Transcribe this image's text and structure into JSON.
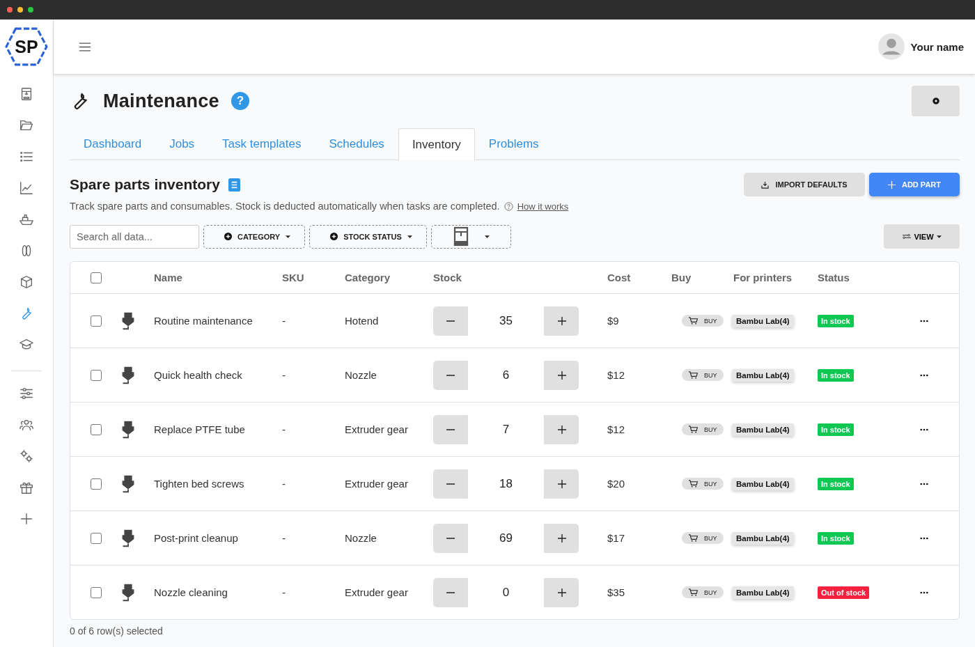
{
  "app": {
    "logo": "SP"
  },
  "sidebar": {
    "items": [
      {
        "selected": false
      },
      {
        "selected": false
      },
      {
        "selected": false
      },
      {
        "selected": false
      },
      {
        "selected": false
      },
      {
        "selected": false
      },
      {
        "selected": false
      },
      {
        "selected": true
      },
      {
        "selected": false
      },
      {
        "selected": false
      },
      {
        "selected": false
      },
      {
        "selected": false
      },
      {
        "selected": false
      },
      {
        "selected": false
      }
    ]
  },
  "header": {
    "user_name": "Your name"
  },
  "page": {
    "title": "Maintenance",
    "help": "?"
  },
  "tabs": [
    {
      "label": "Dashboard",
      "selected": false
    },
    {
      "label": "Jobs",
      "selected": false
    },
    {
      "label": "Task templates",
      "selected": false
    },
    {
      "label": "Schedules",
      "selected": false
    },
    {
      "label": "Inventory",
      "selected": true
    },
    {
      "label": "Problems",
      "selected": false
    }
  ],
  "section": {
    "title": "Spare parts inventory",
    "description": "Track spare parts and consumables. Stock is deducted automatically when tasks are completed.",
    "link": "How it works",
    "buttons": [
      {
        "label": "IMPORT DEFAULTS",
        "kind": "secondary"
      },
      {
        "label": "ADD PART",
        "kind": "primary"
      }
    ]
  },
  "toolbar": {
    "search": {
      "placeholder": "Search all data..."
    },
    "filters": [
      {
        "kind": "text",
        "label": "CATEGORY"
      },
      {
        "kind": "text",
        "label": "STOCK STATUS"
      },
      {
        "kind": "printer"
      }
    ],
    "view": "VIEW"
  },
  "table": {
    "header_checked": false,
    "columns": [
      "Name",
      "SKU",
      "Category",
      "Stock",
      "Cost",
      "Buy",
      "For printers",
      "Status"
    ],
    "rows": [
      {
        "checked": false,
        "name": "Routine maintenance",
        "sku": "-",
        "category": "Hotend",
        "stock": "35",
        "cost": "$9",
        "buy": "BUY",
        "printers": "Bambu Lab(4)",
        "status": "In stock",
        "color": "#0fc753"
      },
      {
        "checked": false,
        "name": "Quick health check",
        "sku": "-",
        "category": "Nozzle",
        "stock": "6",
        "cost": "$12",
        "buy": "BUY",
        "printers": "Bambu Lab(4)",
        "status": "In stock",
        "color": "#0fc753"
      },
      {
        "checked": false,
        "name": "Replace PTFE tube",
        "sku": "-",
        "category": "Extruder gear",
        "stock": "7",
        "cost": "$12",
        "buy": "BUY",
        "printers": "Bambu Lab(4)",
        "status": "In stock",
        "color": "#0fc753"
      },
      {
        "checked": false,
        "name": "Tighten bed screws",
        "sku": "-",
        "category": "Extruder gear",
        "stock": "18",
        "cost": "$20",
        "buy": "BUY",
        "printers": "Bambu Lab(4)",
        "status": "In stock",
        "color": "#0fc753"
      },
      {
        "checked": false,
        "name": "Post-print cleanup",
        "sku": "-",
        "category": "Nozzle",
        "stock": "69",
        "cost": "$17",
        "buy": "BUY",
        "printers": "Bambu Lab(4)",
        "status": "In stock",
        "color": "#0fc753"
      },
      {
        "checked": false,
        "name": "Nozzle cleaning",
        "sku": "-",
        "category": "Extruder gear",
        "stock": "0",
        "cost": "$35",
        "buy": "BUY",
        "printers": "Bambu Lab(4)",
        "status": "Out of stock",
        "color": "#f5213f"
      }
    ]
  },
  "footer": {
    "selection": "0 of 6 row(s) selected"
  }
}
